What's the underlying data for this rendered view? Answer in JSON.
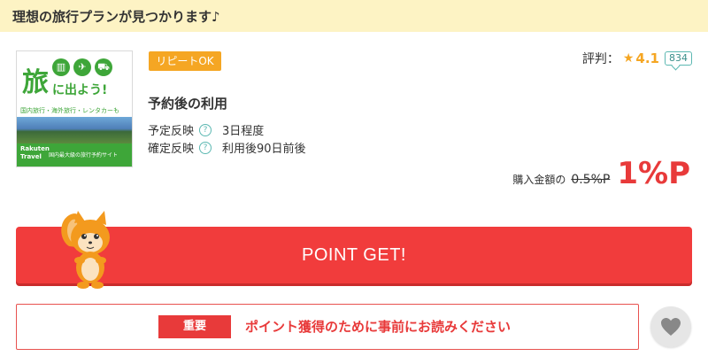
{
  "banner": {
    "title": "理想の旅行プランが見つかります♪"
  },
  "logo": {
    "kanji": "旅",
    "slogan": "に出よう!",
    "sub": "国内旅行・海外旅行・レンタカーも",
    "brand": "Rakuten Travel",
    "tagline": "国内最大級の旅行予約サイト",
    "icons": [
      "hotel-icon",
      "airplane-icon",
      "car-icon"
    ]
  },
  "badge": {
    "label": "リピートOK"
  },
  "rating": {
    "label": "評判：",
    "star": "★",
    "value": "4.1",
    "count": "834"
  },
  "usage": {
    "title": "予約後の利用"
  },
  "details": [
    {
      "label": "予定反映",
      "value": "3日程度"
    },
    {
      "label": "確定反映",
      "value": "利用後90日前後"
    }
  ],
  "price": {
    "label": "購入金額の",
    "old": "0.5%P",
    "new": "1%P"
  },
  "cta": {
    "label": "POINT GET!"
  },
  "notice": {
    "tag": "重要",
    "text": "ポイント獲得のために事前にお読みください"
  },
  "colors": {
    "accent": "#f13c3c",
    "badge": "#f5a623",
    "banner": "#fdf3c4",
    "brand_green": "#3ea639"
  }
}
